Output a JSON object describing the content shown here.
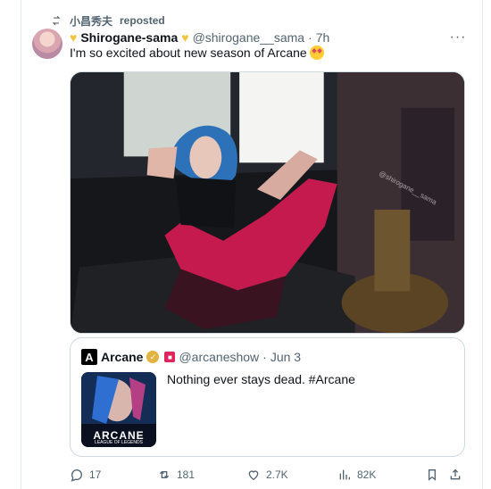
{
  "repost": {
    "user": "小昌秀夫",
    "text": "reposted"
  },
  "tweet": {
    "display_name": "Shirogane-sama",
    "handle": "@shirogane__sama",
    "separator": "·",
    "time": "7h",
    "more": "···",
    "text": "I'm so excited about new season of Arcane",
    "emoji": "star-struck-emoji",
    "image_watermark": "@shirogane__sama"
  },
  "quote": {
    "logo": "A",
    "name": "Arcane",
    "handle": "@arcaneshow",
    "separator": "·",
    "time": "Jun 3",
    "text": "Nothing ever stays dead. #Arcane",
    "thumb_title": "ARCANE",
    "thumb_subtitle": "LEAGUE OF LEGENDS"
  },
  "actions": {
    "replies": "17",
    "reposts": "181",
    "likes": "2.7K",
    "views": "82K"
  },
  "colors": {
    "text": "#0f1419",
    "muted": "#536471",
    "border": "#cfd9de",
    "gold": "#f4c542",
    "verified_gold": "#e3b341",
    "red_badge": "#e0245e"
  },
  "icons": [
    "repost-icon",
    "heart-emoji",
    "more-icon",
    "gold-verified-icon",
    "red-badge-icon",
    "reply-icon",
    "like-icon",
    "views-icon",
    "bookmark-icon",
    "share-icon"
  ]
}
